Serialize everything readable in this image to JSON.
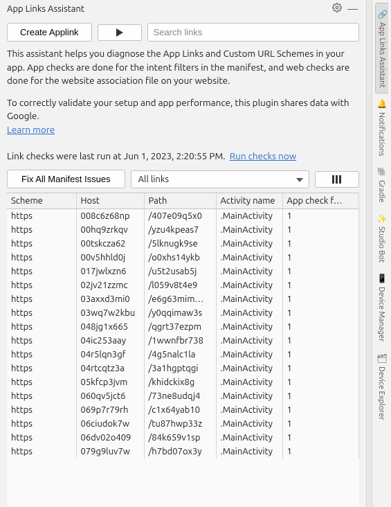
{
  "header": {
    "title": "App Links Assistant"
  },
  "toolbar": {
    "create_label": "Create Applink",
    "search_placeholder": "Search links"
  },
  "description": {
    "p1": "This assistant helps you diagnose the App Links and Custom URL Schemes in your app. App checks are done for the intent filters in the manifest, and web checks are done for the website association file on your website.",
    "p2": "To correctly validate your setup and app performance, this plugin shares data with Google.",
    "learn_more": "Learn more"
  },
  "runStatus": {
    "prefix": "Link checks were last run at ",
    "time": "Jun 1, 2023, 2:20:55 PM.",
    "run_now": "Run checks now"
  },
  "filters": {
    "fix_label": "Fix All Manifest Issues",
    "dropdown_value": "All links"
  },
  "columns": {
    "scheme": "Scheme",
    "host": "Host",
    "path": "Path",
    "activity": "Activity name",
    "appcheck": "App check f…"
  },
  "rows": [
    {
      "scheme": "https",
      "host": "008c6z68np",
      "path": "/407e09q5x0",
      "activity": ".MainActivity",
      "appcheck": "1"
    },
    {
      "scheme": "https",
      "host": "00hq9zrkqv",
      "path": "/yzu4kpeas7",
      "activity": ".MainActivity",
      "appcheck": "1"
    },
    {
      "scheme": "https",
      "host": "00tskcza62",
      "path": "/5lknugk9se",
      "activity": ".MainActivity",
      "appcheck": "1"
    },
    {
      "scheme": "https",
      "host": "00v5hhld0j",
      "path": "/o0xhs14ykb",
      "activity": ".MainActivity",
      "appcheck": "1"
    },
    {
      "scheme": "https",
      "host": "017jwlxzn6",
      "path": "/u5t2usab5j",
      "activity": ".MainActivity",
      "appcheck": "1"
    },
    {
      "scheme": "https",
      "host": "02jv21zzmc",
      "path": "/l059v8t4e9",
      "activity": ".MainActivity",
      "appcheck": "1"
    },
    {
      "scheme": "https",
      "host": "03axxd3mi0",
      "path": "/e6g63mim…",
      "activity": ".MainActivity",
      "appcheck": "1"
    },
    {
      "scheme": "https",
      "host": "03wq7w2kbu",
      "path": "/y0qqimaw3s",
      "activity": ".MainActivity",
      "appcheck": "1"
    },
    {
      "scheme": "https",
      "host": "048jg1x665",
      "path": "/qgrt37ezpm",
      "activity": ".MainActivity",
      "appcheck": "1"
    },
    {
      "scheme": "https",
      "host": "04ic253aay",
      "path": "/1wwnfbr738",
      "activity": ".MainActivity",
      "appcheck": "1"
    },
    {
      "scheme": "https",
      "host": "04r5lqn3gf",
      "path": "/4g5nalc1la",
      "activity": ".MainActivity",
      "appcheck": "1"
    },
    {
      "scheme": "https",
      "host": "04rtcqtz3a",
      "path": "/3a1hgptqgi",
      "activity": ".MainActivity",
      "appcheck": "1"
    },
    {
      "scheme": "https",
      "host": "05kfcp3jvm",
      "path": "/khidckix8g",
      "activity": ".MainActivity",
      "appcheck": "1"
    },
    {
      "scheme": "https",
      "host": "060qv5jct6",
      "path": "/73ne8udqj4",
      "activity": ".MainActivity",
      "appcheck": "1"
    },
    {
      "scheme": "https",
      "host": "069p7r79rh",
      "path": "/c1x64yab10",
      "activity": ".MainActivity",
      "appcheck": "1"
    },
    {
      "scheme": "https",
      "host": "06ciudok7w",
      "path": "/tu87hwp33z",
      "activity": ".MainActivity",
      "appcheck": "1"
    },
    {
      "scheme": "https",
      "host": "06dv02o409",
      "path": "/84k659v1sp",
      "activity": ".MainActivity",
      "appcheck": "1"
    },
    {
      "scheme": "https",
      "host": "079g9luv7w",
      "path": "/h7bd07ox3y",
      "activity": ".MainActivity",
      "appcheck": "1"
    }
  ],
  "rail": {
    "tabs": [
      {
        "label": "App Links Assistant",
        "icon": "🔗"
      },
      {
        "label": "Notifications",
        "icon": "🔔"
      },
      {
        "label": "Gradle",
        "icon": "🐘"
      },
      {
        "label": "Studio Bot",
        "icon": "✨"
      },
      {
        "label": "Device Manager",
        "icon": "📱"
      },
      {
        "label": "Device Explorer",
        "icon": "🗂"
      }
    ]
  }
}
